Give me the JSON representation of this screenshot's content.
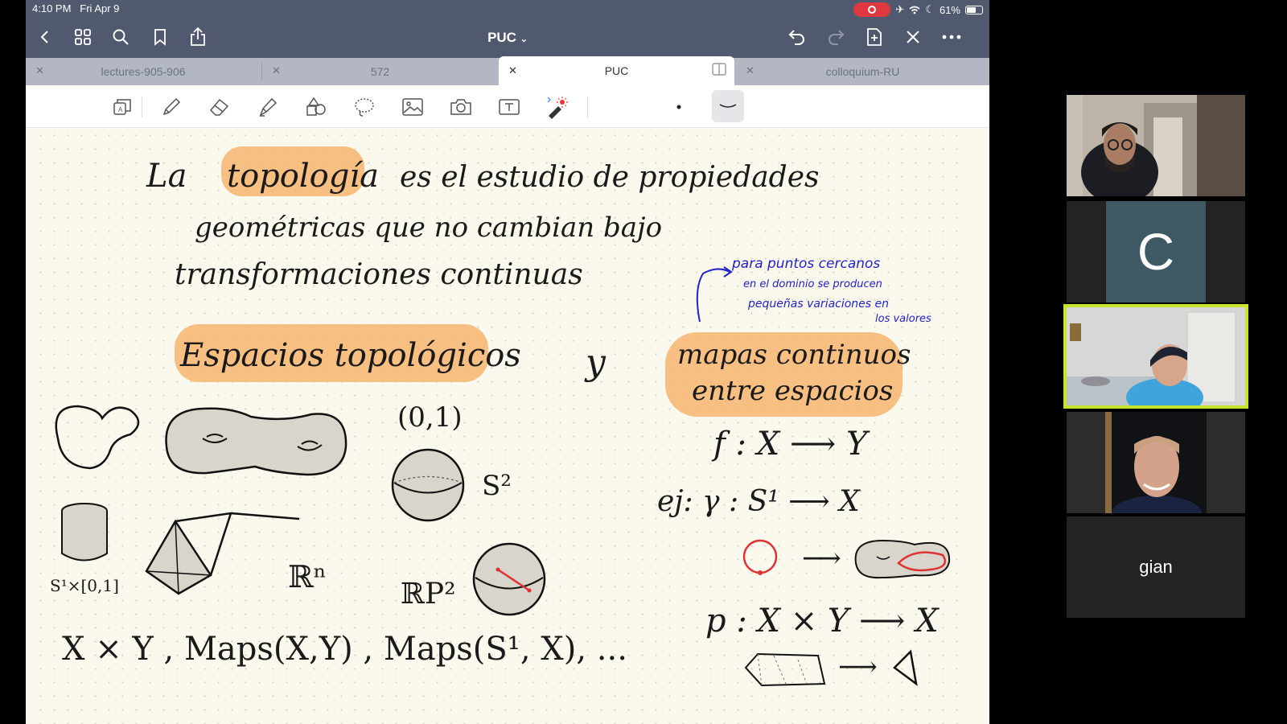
{
  "status_bar": {
    "time": "4:10 PM",
    "date": "Fri Apr 9",
    "battery": "61%",
    "battery_level": 0.61
  },
  "nav": {
    "doc_title": "PUC",
    "doc_title_chevron": "chevron-down-icon",
    "left_icons": [
      "back-chevron-icon",
      "grid-icon",
      "search-icon",
      "bookmark-icon",
      "share-icon"
    ],
    "right_icons": [
      "undo-icon",
      "redo-icon",
      "add-page-icon",
      "close-icon",
      "more-icon"
    ]
  },
  "tabs": [
    {
      "label": "lectures-905-906",
      "active": false
    },
    {
      "label": "572",
      "active": false
    },
    {
      "label": "PUC",
      "active": true
    },
    {
      "label": "colloquium-RU",
      "active": false
    }
  ],
  "tools": [
    "page-tool-icon",
    "pen-icon",
    "eraser-icon",
    "highlighter-icon",
    "shapes-icon",
    "lasso-icon",
    "image-icon",
    "camera-icon",
    "text-box-icon",
    "laser-pointer-icon",
    "dot-stroke-icon",
    "thin-stroke-icon"
  ],
  "notes": {
    "line1": [
      "La",
      "topología",
      "es el estudio de propiedades"
    ],
    "line2": "geométricas que no cambian bajo",
    "line3": "transformaciones continuas",
    "annotation": [
      "para puntos cercanos",
      "en el dominio se producen",
      "pequeñas variaciones en",
      "los valores"
    ],
    "heading_left": "Espacios topológicos",
    "conj": "y",
    "heading_right": [
      "mapas continuos",
      "entre espacios"
    ],
    "interval": "(0,1)",
    "sphere": "S²",
    "cylinder": "S¹×[0,1]",
    "rn": "ℝⁿ",
    "rp2": "ℝP²",
    "bottom_left": "X × Y ,  Maps(X,Y) ,  Maps(S¹, X), ...",
    "map_f": "f : X ⟶ Y",
    "map_ej": "ej: γ : S¹ ⟶ X",
    "map_p": "p : X × Y ⟶ X",
    "arrow": "⟶"
  },
  "zoom": {
    "participants": [
      {
        "type": "video",
        "label": ""
      },
      {
        "type": "initial",
        "label": "C"
      },
      {
        "type": "video",
        "label": "",
        "active_speaker": true
      },
      {
        "type": "video",
        "label": ""
      },
      {
        "type": "name",
        "label": "gian"
      }
    ]
  }
}
